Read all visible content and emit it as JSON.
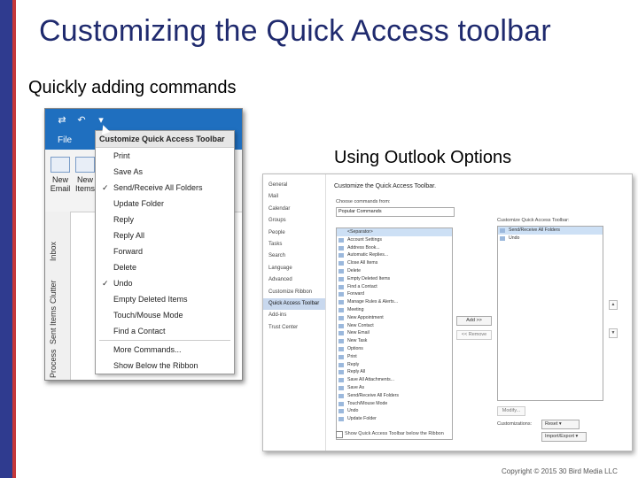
{
  "slide": {
    "title": "Customizing the Quick Access toolbar",
    "subtitle_left": "Quickly adding commands",
    "subtitle_right": "Using Outlook Options",
    "copyright": "Copyright © 2015 30 Bird Media LLC"
  },
  "colors": {
    "title": "#1f2a6e",
    "left_bar": "#2f3b8f",
    "left_bar_accent": "#c6383a",
    "outlook_blue": "#1f6fbf"
  },
  "shot1": {
    "file_tab": "File",
    "ribbon_buttons": [
      {
        "label": "New Email"
      },
      {
        "label": "New Items"
      }
    ],
    "side_tabs": [
      "Inbox",
      "Clutter",
      "Sent Items",
      "Process"
    ],
    "menu": {
      "header": "Customize Quick Access Toolbar",
      "items": [
        {
          "label": "Print",
          "checked": false
        },
        {
          "label": "Save As",
          "checked": false
        },
        {
          "label": "Send/Receive All Folders",
          "checked": true
        },
        {
          "label": "Update Folder",
          "checked": false
        },
        {
          "label": "Reply",
          "checked": false
        },
        {
          "label": "Reply All",
          "checked": false
        },
        {
          "label": "Forward",
          "checked": false
        },
        {
          "label": "Delete",
          "checked": false
        },
        {
          "label": "Undo",
          "checked": true
        },
        {
          "label": "Empty Deleted Items",
          "checked": false
        },
        {
          "label": "Touch/Mouse Mode",
          "checked": false
        },
        {
          "label": "Find a Contact",
          "checked": false
        }
      ],
      "more_commands": "More Commands...",
      "show_below": "Show Below the Ribbon"
    }
  },
  "shot2": {
    "nav": [
      "General",
      "Mail",
      "Calendar",
      "Groups",
      "People",
      "Tasks",
      "Search",
      "Language",
      "Advanced",
      "Customize Ribbon",
      "Quick Access Toolbar",
      "Add-ins",
      "Trust Center"
    ],
    "nav_active": "Quick Access Toolbar",
    "heading": "Customize the Quick Access Toolbar.",
    "choose_label": "Choose commands from:",
    "choose_value": "Popular Commands",
    "commands": [
      "<Separator>",
      "Account Settings",
      "Address Book...",
      "Automatic Replies...",
      "Close All Items",
      "Delete",
      "Empty Deleted Items",
      "Find a Contact",
      "Forward",
      "Manage Rules & Alerts...",
      "Meeting",
      "New Appointment",
      "New Contact",
      "New Email",
      "New Task",
      "Options",
      "Print",
      "Reply",
      "Reply All",
      "Save All Attachments...",
      "Save As",
      "Send/Receive All Folders",
      "Touch/Mouse Mode",
      "Undo",
      "Update Folder"
    ],
    "add_button": "Add >>",
    "remove_button": "<< Remove",
    "customize_label": "Customize Quick Access Toolbar:",
    "customize_items": [
      "Send/Receive All Folders",
      "Undo"
    ],
    "modify_button": "Modify...",
    "customizations_label": "Customizations:",
    "reset_button": "Reset ▾",
    "import_export_button": "Import/Export ▾",
    "show_below_label": "Show Quick Access Toolbar below the Ribbon"
  }
}
